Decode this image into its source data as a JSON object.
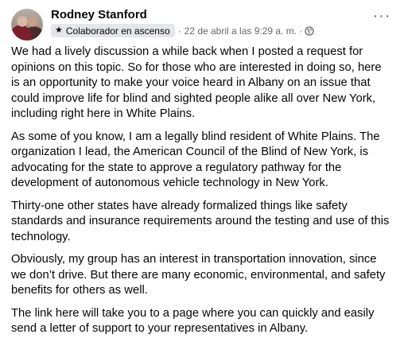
{
  "post": {
    "author": "Rodney Stanford",
    "badge": "Colaborador en ascenso",
    "separator": "·",
    "timestamp": "22 de abril a las 9:29 a. m.",
    "time_separator": "·",
    "more_label": "···",
    "paragraphs": [
      "We had a lively discussion a while back when I posted a request for opinions on this topic. So for those who are interested in doing so, here is an opportunity to make your voice heard in Albany on an issue that could improve life for blind  and sighted people alike all over New York, including right here in White Plains.",
      "As some of you know, I am a legally blind resident of White Plains. The organization I lead, the American Council of the Blind of New York, is advocating for the state to approve a regulatory pathway for the development of autonomous vehicle technology in New York.",
      "Thirty-one other states have already formalized things like safety standards and insurance requirements around the testing and use of this technology.",
      "Obviously, my group has an interest in transportation innovation, since we don’t drive. But there are many economic, environmental, and safety benefits for others as well.",
      "The link here will take you to a page where you can quickly and easily send a letter of support to your representatives in Albany."
    ]
  },
  "icons": {
    "badge": "star-icon",
    "privacy": "globe-icon",
    "menu": "more-options-icon"
  }
}
